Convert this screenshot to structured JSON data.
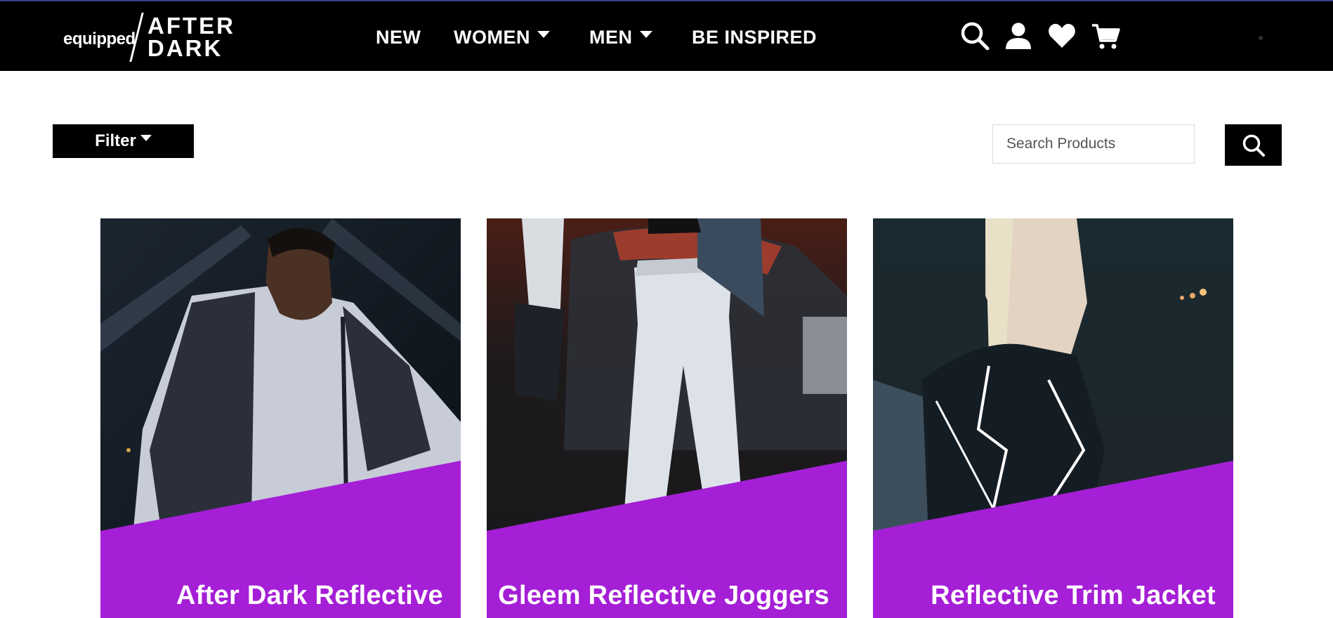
{
  "brand": {
    "prefix": "equipped",
    "line1": "AFTER",
    "line2": "DARK"
  },
  "nav": {
    "items": [
      {
        "label": "NEW"
      },
      {
        "label": "WOMEN"
      },
      {
        "label": "MEN"
      },
      {
        "label": "BE INSPIRED"
      }
    ]
  },
  "header_icons": [
    "search-icon",
    "user-icon",
    "heart-icon",
    "cart-icon"
  ],
  "toolbar": {
    "filter_label": "Filter",
    "search_placeholder": "Search Products"
  },
  "colors": {
    "header_bg": "#000000",
    "accent_purple": "#a51fd6",
    "text_on_dark": "#ffffff"
  },
  "products": [
    {
      "title": "After Dark Reflective"
    },
    {
      "title": "Gleem Reflective Joggers"
    },
    {
      "title": "Reflective Trim Jacket"
    }
  ]
}
